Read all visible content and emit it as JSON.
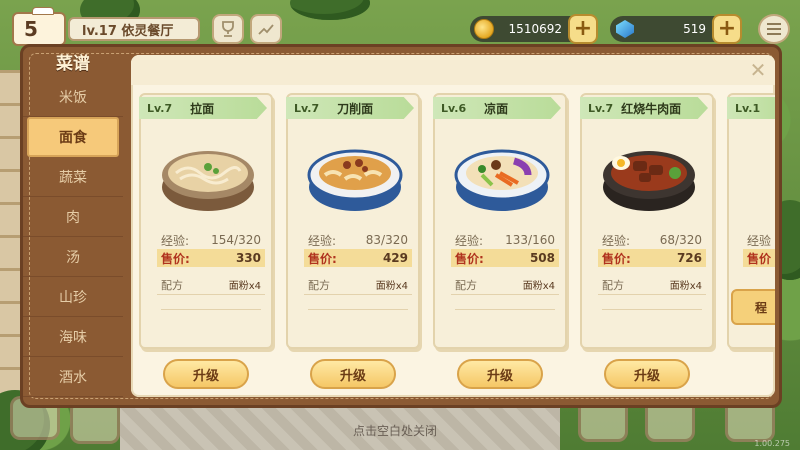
{
  "hud": {
    "level_number": "5",
    "restaurant_name": "lv.17 依灵餐厅",
    "trophy_icon": "trophy-icon",
    "chart_icon": "chart-icon",
    "coins": "1510692",
    "gems": "519",
    "plus_label": "+"
  },
  "sidebar": {
    "title": "菜谱",
    "items": [
      {
        "label": "米饭"
      },
      {
        "label": "面食",
        "active": true
      },
      {
        "label": "蔬菜"
      },
      {
        "label": "肉"
      },
      {
        "label": "汤"
      },
      {
        "label": "山珍"
      },
      {
        "label": "海味"
      },
      {
        "label": "酒水"
      }
    ]
  },
  "close_label": "✕",
  "labels": {
    "exp": "经验:",
    "price": "售价:",
    "recipe": "配方",
    "upgrade": "升级"
  },
  "cards": [
    {
      "level": "Lv.7",
      "name": "拉面",
      "exp": "154/320",
      "price": "330",
      "ingredient": "面粉x4"
    },
    {
      "level": "Lv.7",
      "name": "刀削面",
      "exp": "83/320",
      "price": "429",
      "ingredient": "面粉x4"
    },
    {
      "level": "Lv.6",
      "name": "凉面",
      "exp": "133/160",
      "price": "508",
      "ingredient": "面粉x4"
    },
    {
      "level": "Lv.7",
      "name": "红烧牛肉面",
      "exp": "68/320",
      "price": "726",
      "ingredient": "面粉x4"
    },
    {
      "level": "Lv.1",
      "exp_label_partial": "经验",
      "price_label_partial": "售价",
      "button_partial": "程"
    }
  ],
  "hint": "点击空白处关闭",
  "corner_text": "1.00.275"
}
